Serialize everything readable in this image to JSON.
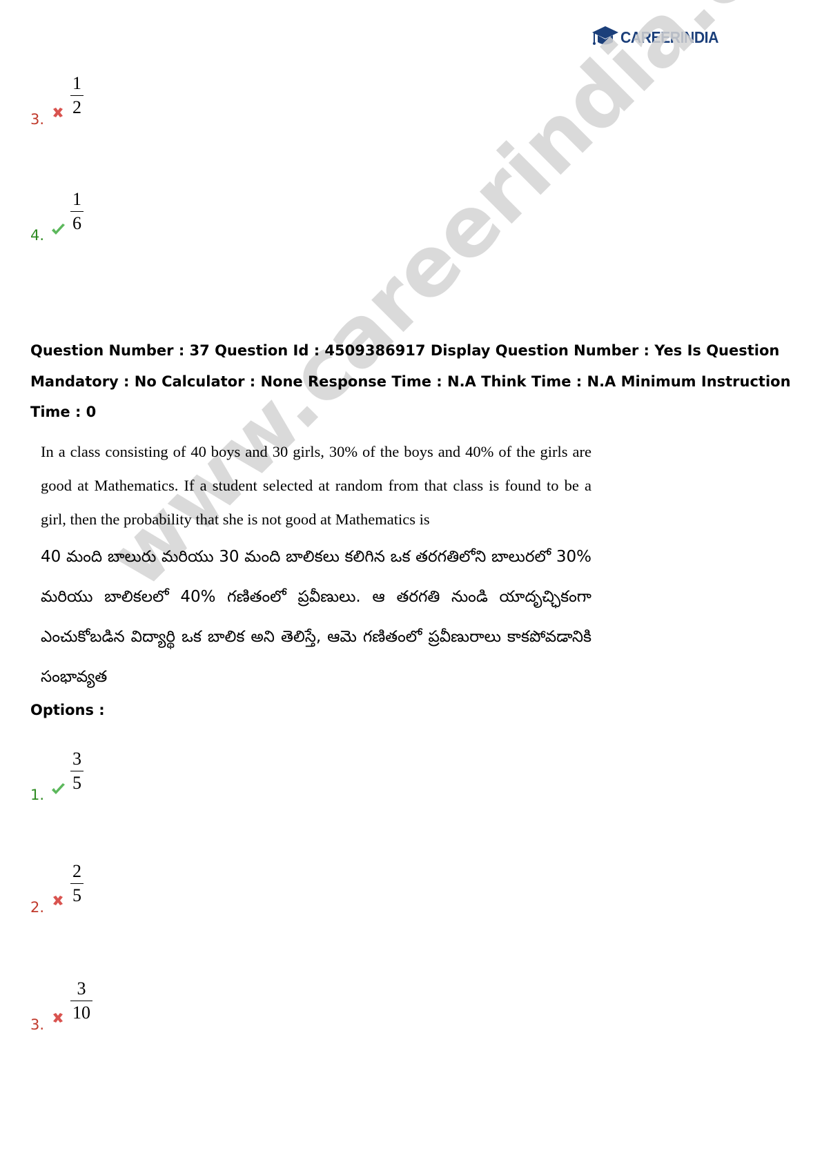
{
  "brand": {
    "logo_career": "CAREER",
    "logo_india": "INDIA",
    "watermark": "www.careerindia.com"
  },
  "prev_options": [
    {
      "number": "3.",
      "status": "wrong",
      "numerator": "1",
      "denominator": "2"
    },
    {
      "number": "4.",
      "status": "correct",
      "numerator": "1",
      "denominator": "6"
    }
  ],
  "question": {
    "header": "Question Number : 37 Question Id : 4509386917 Display Question Number : Yes Is Question Mandatory : No Calculator : None Response Time : N.A Think Time : N.A Minimum Instruction Time : 0",
    "text_en": "In a class consisting of 40 boys and 30 girls, 30% of the boys and 40% of the girls are good at Mathematics. If a student selected at random from that class is found to be a girl, then the probability that she is not good at Mathematics is",
    "text_te": "40 మంది బాలురు మరియు 30 మంది బాలికలు కలిగిన ఒక తరగతిలోని బాలురలో 30% మరియు బాలికలలో 40% గణితంలో ప్రవీణులు. ఆ తరగతి నుండి యాదృచ్ఛికంగా ఎంచుకోబడిన విద్యార్థి ఒక బాలిక అని తెలిస్తే, ఆమె గణితంలో ప్రవీణురాలు కాకపోవడానికి సంభావ్యత"
  },
  "options_label": "Options :",
  "options": [
    {
      "number": "1.",
      "status": "correct",
      "numerator": "3",
      "denominator": "5"
    },
    {
      "number": "2.",
      "status": "wrong",
      "numerator": "2",
      "denominator": "5"
    },
    {
      "number": "3.",
      "status": "wrong",
      "numerator": "3",
      "denominator": "10"
    }
  ],
  "colors": {
    "wrong": "#c0392b",
    "correct": "#2e8b22",
    "brand": "#1b3f7a",
    "watermark": "#d4d4d4"
  }
}
